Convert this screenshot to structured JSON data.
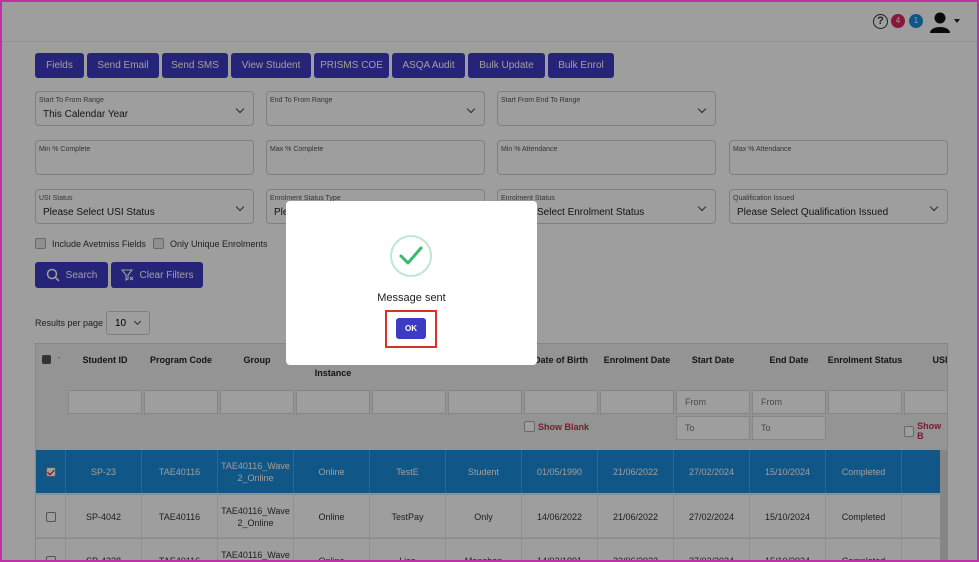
{
  "header": {
    "help_glyph": "?",
    "notif_red_count": "4",
    "notif_blue_count": "1"
  },
  "toolbar": [
    "Fields",
    "Send Email",
    "Send SMS",
    "View Student",
    "PRISMS COE",
    "ASQA Audit",
    "Bulk Update",
    "Bulk Enrol"
  ],
  "filters": {
    "start_to_from_range": {
      "label": "Start To From Range",
      "value": "This Calendar Year"
    },
    "end_to_from_range": {
      "label": "End To From Range",
      "value": ""
    },
    "start_from_end_to_range": {
      "label": "Start From End To Range",
      "value": ""
    },
    "min_complete": {
      "label": "Min % Complete"
    },
    "max_complete": {
      "label": "Max % Complete"
    },
    "min_attendance": {
      "label": "Min % Attendance"
    },
    "max_attendance": {
      "label": "Max % Attendance"
    },
    "usi_status": {
      "label": "USI Status",
      "value": "Please Select USI Status"
    },
    "enrolment_status_type": {
      "label": "Enrolment Status Type",
      "value": "Ple"
    },
    "enrolment_status": {
      "label": "Enrolment Status",
      "value": "Select Enrolment Status"
    },
    "qualification_issued": {
      "label": "Qualification Issued",
      "value": "Please Select Qualification Issued"
    },
    "include_avetmiss": "Include Avetmiss Fields",
    "only_unique": "Only Unique Enrolments",
    "search_label": "Search",
    "clear_label": "Clear Filters"
  },
  "results_per_page": {
    "label": "Results per page",
    "value": "10"
  },
  "table": {
    "headers": [
      "Student ID",
      "Program Code",
      "Group",
      "Instance",
      "Date of Birth",
      "Enrolment Date",
      "Start Date",
      "End Date",
      "Enrolment Status",
      "USI"
    ],
    "date_from": "From",
    "date_to": "To",
    "show_blank": "Show Blank",
    "show_blank_cut": "Show B",
    "rows": [
      {
        "student_id": "SP-23",
        "program": "TAE40116",
        "group": "TAE40116_Wave 2_Online",
        "instance": "Online",
        "col5": "TestE",
        "col6": "Student",
        "dob": "01/05/1990",
        "enrol_date": "21/06/2022",
        "start": "27/02/2024",
        "end": "15/10/2024",
        "status": "Completed",
        "selected": true
      },
      {
        "student_id": "SP-4042",
        "program": "TAE40116",
        "group": "TAE40116_Wave 2_Online",
        "instance": "Online",
        "col5": "TestPay",
        "col6": "Only",
        "dob": "14/06/2022",
        "enrol_date": "21/06/2022",
        "start": "27/02/2024",
        "end": "15/10/2024",
        "status": "Completed",
        "selected": false
      },
      {
        "student_id": "SP-4338",
        "program": "TAE40116",
        "group": "TAE40116_Wave 2_Online",
        "instance": "Online",
        "col5": "Lisa",
        "col6": "Manoban",
        "dob": "14/02/1991",
        "enrol_date": "23/06/2022",
        "start": "27/02/2024",
        "end": "15/10/2024",
        "status": "Completed",
        "selected": false
      }
    ]
  },
  "modal": {
    "message": "Message sent",
    "ok_label": "OK"
  },
  "colors": {
    "accent": "#3d3bc4",
    "selected_row": "#1a8cd8",
    "highlight": "#d6322a",
    "success": "#3cb96a"
  }
}
